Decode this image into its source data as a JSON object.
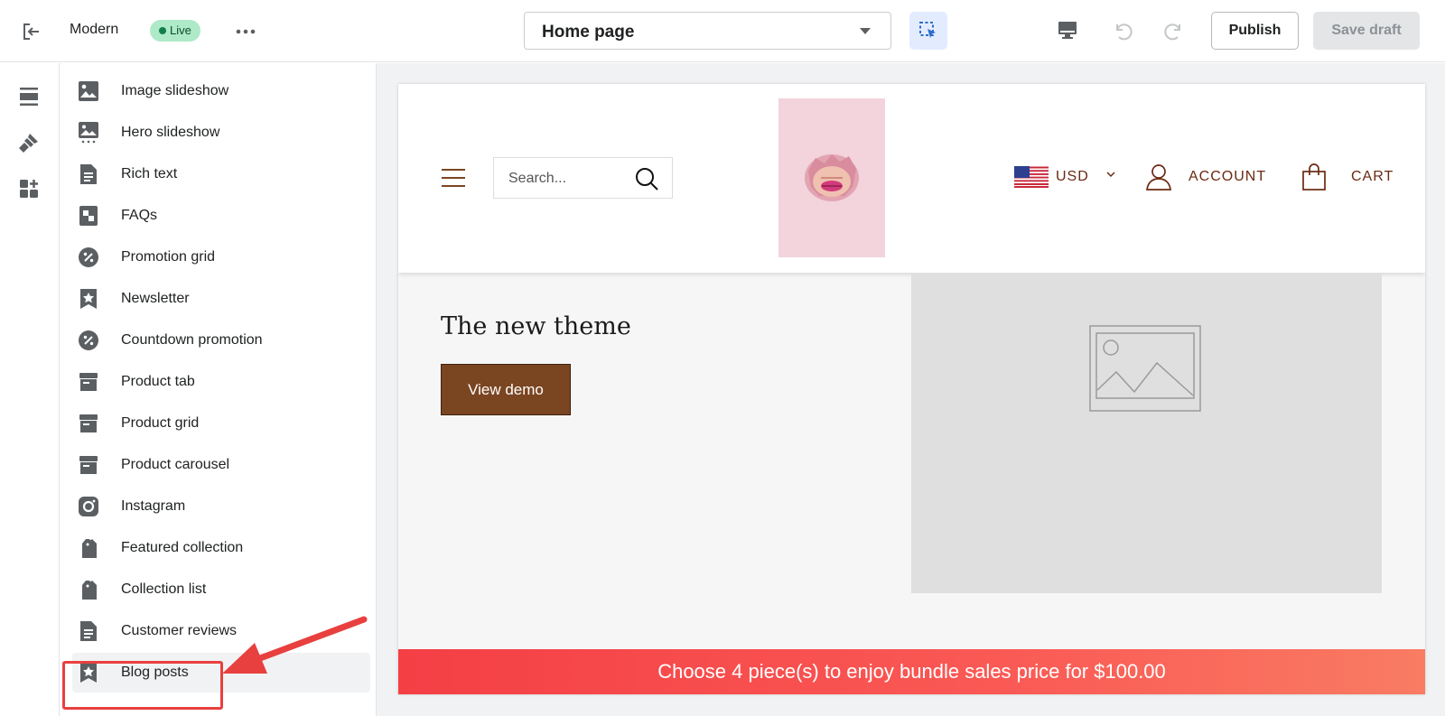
{
  "topbar": {
    "theme_name": "Modern",
    "status_badge": "Live",
    "page_selector": "Home page",
    "publish_label": "Publish",
    "save_draft_label": "Save draft",
    "icons": [
      "exit-icon",
      "more-icon",
      "inspector-icon",
      "desktop-icon",
      "undo-icon",
      "redo-icon"
    ]
  },
  "rail": {
    "icons": [
      "sections-icon",
      "theme-settings-icon",
      "apps-icon"
    ]
  },
  "sections": {
    "items": [
      {
        "label": "Image slideshow",
        "icon": "image-icon"
      },
      {
        "label": "Hero slideshow",
        "icon": "slideshow-icon"
      },
      {
        "label": "Rich text",
        "icon": "text-document-icon"
      },
      {
        "label": "FAQs",
        "icon": "faq-icon"
      },
      {
        "label": "Promotion grid",
        "icon": "discount-icon"
      },
      {
        "label": "Newsletter",
        "icon": "star-icon"
      },
      {
        "label": "Countdown promotion",
        "icon": "discount-icon"
      },
      {
        "label": "Product tab",
        "icon": "product-icon"
      },
      {
        "label": "Product grid",
        "icon": "product-icon"
      },
      {
        "label": "Product carousel",
        "icon": "product-icon"
      },
      {
        "label": "Instagram",
        "icon": "instagram-icon"
      },
      {
        "label": "Featured collection",
        "icon": "collection-icon"
      },
      {
        "label": "Collection list",
        "icon": "collection-icon"
      },
      {
        "label": "Customer reviews",
        "icon": "text-document-icon"
      },
      {
        "label": "Blog posts",
        "icon": "star-icon"
      }
    ],
    "highlighted": "Blog posts"
  },
  "preview": {
    "search_placeholder": "Search...",
    "currency": "USD",
    "account_label": "ACCOUNT",
    "cart_label": "CART",
    "hero_title": "The new theme",
    "hero_button": "View demo",
    "banner_text": "Choose 4 piece(s) to enjoy bundle sales price for $100.00"
  },
  "colors": {
    "accent_brown": "#7a4521",
    "header_text": "#6b2a12",
    "banner_red": "#f43f45",
    "highlight_red": "#e8403f",
    "live_badge": "#aee9c8"
  }
}
